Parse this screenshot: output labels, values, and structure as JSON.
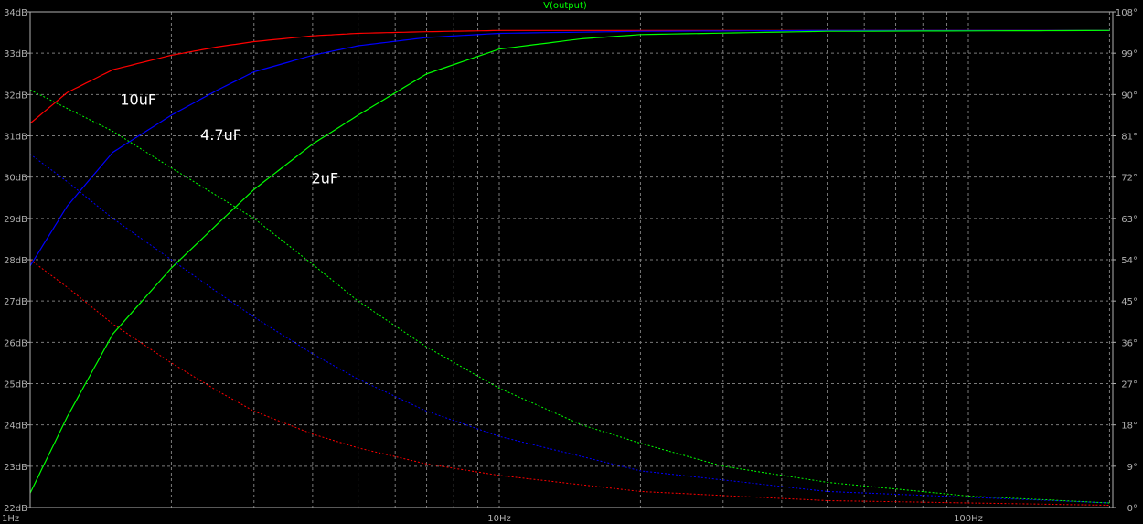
{
  "chart_data": {
    "type": "line",
    "title": "V(output)",
    "x_scale": "log",
    "xlim": [
      1,
      200
    ],
    "x_ticks": [
      {
        "value": 1,
        "label": "1Hz"
      },
      {
        "value": 10,
        "label": "10Hz"
      },
      {
        "value": 100,
        "label": "100Hz"
      }
    ],
    "y_left": {
      "lim": [
        22,
        34
      ],
      "ticks": [
        22,
        23,
        24,
        25,
        26,
        27,
        28,
        29,
        30,
        31,
        32,
        33,
        34
      ],
      "labels": [
        "22dB",
        "23dB",
        "24dB",
        "25dB",
        "26dB",
        "27dB",
        "28dB",
        "29dB",
        "30dB",
        "31dB",
        "32dB",
        "33dB",
        "34dB"
      ]
    },
    "y_right": {
      "lim": [
        0,
        108
      ],
      "ticks": [
        0,
        9,
        18,
        27,
        36,
        45,
        54,
        63,
        72,
        81,
        90,
        99,
        108
      ],
      "labels": [
        "0°",
        "9°",
        "18°",
        "27°",
        "36°",
        "45°",
        "54°",
        "63°",
        "72°",
        "81°",
        "90°",
        "99°",
        "108°"
      ]
    },
    "grid": true,
    "series": [
      {
        "name": "10uF",
        "color": "#ff0000",
        "magnitude_db": [
          [
            1,
            31.3
          ],
          [
            1.2,
            32.05
          ],
          [
            1.5,
            32.6
          ],
          [
            2,
            32.95
          ],
          [
            2.5,
            33.15
          ],
          [
            3,
            33.28
          ],
          [
            4,
            33.42
          ],
          [
            5,
            33.48
          ],
          [
            7,
            33.52
          ],
          [
            10,
            33.55
          ],
          [
            20,
            33.55
          ],
          [
            50,
            33.55
          ],
          [
            200,
            33.55
          ]
        ],
        "phase_deg": [
          [
            1,
            54
          ],
          [
            1.2,
            48
          ],
          [
            1.5,
            40
          ],
          [
            2,
            31.5
          ],
          [
            2.5,
            25.5
          ],
          [
            3,
            21
          ],
          [
            4,
            16
          ],
          [
            5,
            13
          ],
          [
            7,
            9.5
          ],
          [
            10,
            7
          ],
          [
            20,
            3.5
          ],
          [
            50,
            1.5
          ],
          [
            200,
            0.5
          ]
        ]
      },
      {
        "name": "4.7uF",
        "color": "#0000ff",
        "magnitude_db": [
          [
            1,
            27.85
          ],
          [
            1.2,
            29.3
          ],
          [
            1.5,
            30.6
          ],
          [
            2,
            31.5
          ],
          [
            2.5,
            32.1
          ],
          [
            3,
            32.55
          ],
          [
            4,
            32.95
          ],
          [
            5,
            33.18
          ],
          [
            7,
            33.38
          ],
          [
            10,
            33.48
          ],
          [
            20,
            33.53
          ],
          [
            50,
            33.55
          ],
          [
            200,
            33.55
          ]
        ],
        "phase_deg": [
          [
            1,
            77
          ],
          [
            1.2,
            71
          ],
          [
            1.5,
            63
          ],
          [
            2,
            54
          ],
          [
            2.5,
            47
          ],
          [
            3,
            41.5
          ],
          [
            4,
            33.5
          ],
          [
            5,
            28
          ],
          [
            7,
            21
          ],
          [
            10,
            15.5
          ],
          [
            20,
            8
          ],
          [
            50,
            3.5
          ],
          [
            200,
            1
          ]
        ]
      },
      {
        "name": "2uF",
        "color": "#00ff00",
        "magnitude_db": [
          [
            1,
            22.35
          ],
          [
            1.2,
            24.2
          ],
          [
            1.5,
            26.2
          ],
          [
            2,
            27.8
          ],
          [
            2.5,
            28.85
          ],
          [
            3,
            29.7
          ],
          [
            4,
            30.8
          ],
          [
            5,
            31.5
          ],
          [
            7,
            32.5
          ],
          [
            10,
            33.1
          ],
          [
            15,
            33.35
          ],
          [
            20,
            33.45
          ],
          [
            50,
            33.53
          ],
          [
            200,
            33.55
          ]
        ],
        "phase_deg": [
          [
            1,
            91
          ],
          [
            1.5,
            82
          ],
          [
            2,
            74
          ],
          [
            3,
            63
          ],
          [
            4,
            53
          ],
          [
            5,
            45
          ],
          [
            7,
            35
          ],
          [
            10,
            26
          ],
          [
            15,
            18
          ],
          [
            20,
            14
          ],
          [
            30,
            9
          ],
          [
            50,
            5.5
          ],
          [
            100,
            2.5
          ],
          [
            200,
            1
          ]
        ]
      }
    ],
    "annotations": [
      {
        "text": "10uF",
        "x": 1.7,
        "y_db": 31.75,
        "color": "#ffffff"
      },
      {
        "text": "4.7uF",
        "x": 2.55,
        "y_db": 30.9,
        "color": "#ffffff"
      },
      {
        "text": "2uF",
        "x": 4.25,
        "y_db": 29.85,
        "color": "#ffffff"
      }
    ]
  }
}
